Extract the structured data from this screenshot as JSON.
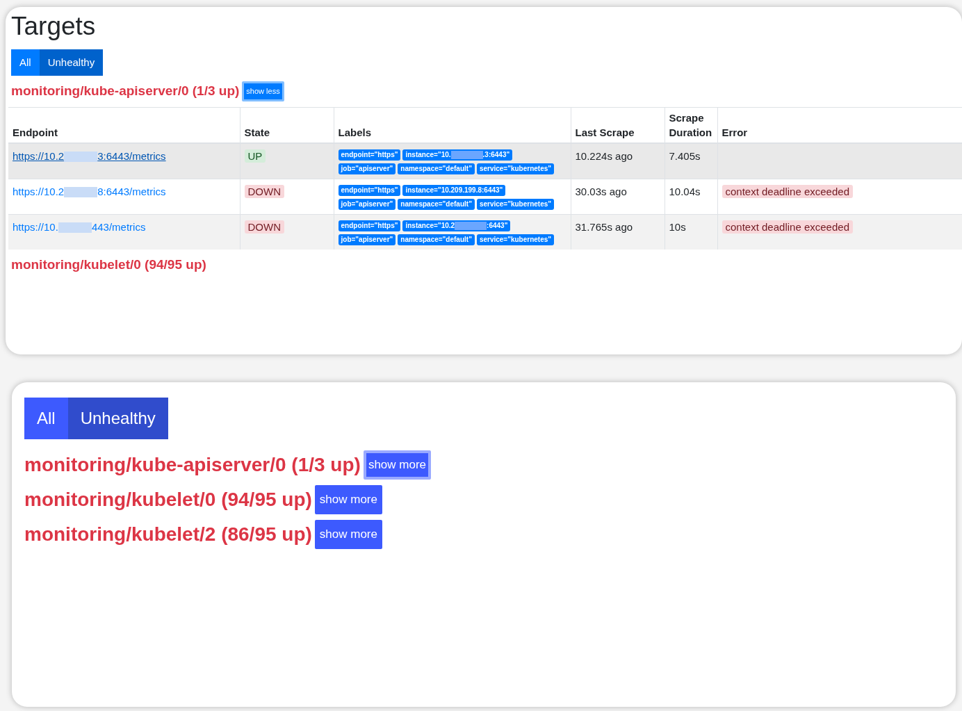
{
  "panels": [
    {
      "kind": "detail",
      "title": "Targets",
      "filters": [
        {
          "label": "All",
          "selected": false
        },
        {
          "label": "Unhealthy",
          "selected": true
        }
      ],
      "groups": [
        {
          "heading": "monitoring/kube-apiserver/0 (1/3 up)",
          "toggle": "show less",
          "focused": true,
          "table": {
            "columns": [
              "Endpoint",
              "State",
              "Labels",
              "Last Scrape",
              "Scrape Duration",
              "Error"
            ],
            "rows": [
              {
                "hovered": true,
                "endpoint": [
                  "https://10.2",
                  "3:6443/metrics"
                ],
                "state": "UP",
                "kind": "up",
                "labels": [
                  [
                    "endpoint=\"https\""
                  ],
                  [
                    "instance=\"10.",
                    ".3:6443\""
                  ],
                  [
                    "job=\"apiserver\""
                  ],
                  [
                    "namespace=\"default\""
                  ],
                  [
                    "service=\"kubernetes\""
                  ]
                ],
                "last_scrape": "10.224s ago",
                "duration": "7.405s"
              },
              {
                "hovered": false,
                "endpoint": [
                  "https://10.2",
                  "8:6443/metrics"
                ],
                "state": "DOWN",
                "kind": "down",
                "labels": [
                  [
                    "endpoint=\"https\""
                  ],
                  [
                    "instance=\"10.209.199.8:6443\""
                  ],
                  [
                    "job=\"apiserver\""
                  ],
                  [
                    "namespace=\"default\""
                  ],
                  [
                    "service=\"kubernetes\""
                  ]
                ],
                "last_scrape": "30.03s ago",
                "duration": "10.04s",
                "error": "context deadline exceeded"
              },
              {
                "hovered": false,
                "endpoint": [
                  "https://10.",
                  "443/metrics"
                ],
                "state": "DOWN",
                "kind": "down",
                "labels": [
                  [
                    "endpoint=\"https\""
                  ],
                  [
                    "instance=\"10.2",
                    ":6443\""
                  ],
                  [
                    "job=\"apiserver\""
                  ],
                  [
                    "namespace=\"default\""
                  ],
                  [
                    "service=\"kubernetes\""
                  ]
                ],
                "last_scrape": "31.765s ago",
                "duration": "10s",
                "error": "context deadline exceeded"
              }
            ]
          }
        },
        {
          "heading": "monitoring/kubelet/0 (94/95 up)"
        }
      ]
    },
    {
      "kind": "summary",
      "filters": [
        {
          "label": "All",
          "selected": false
        },
        {
          "label": "Unhealthy",
          "selected": true
        }
      ],
      "groups": [
        {
          "heading": "monitoring/kube-apiserver/0 (1/3 up)",
          "toggle": "show more",
          "focused": true
        },
        {
          "heading": "monitoring/kubelet/0 (94/95 up)",
          "toggle": "show more",
          "focused": false
        },
        {
          "heading": "monitoring/kubelet/2 (86/95 up)",
          "toggle": "show more",
          "focused": false
        }
      ]
    }
  ]
}
